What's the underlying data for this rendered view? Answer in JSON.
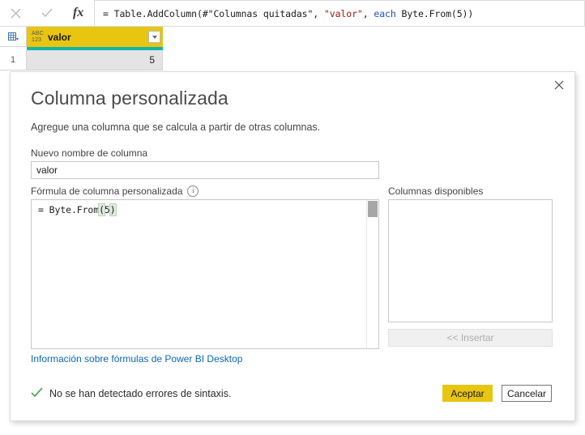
{
  "formula_bar": {
    "cancel_icon": "close-x-icon",
    "accept_icon": "check-icon",
    "fx_label": "fx",
    "formula_segments": {
      "prefix": "= Table.AddColumn(#\"Columnas quitadas\", ",
      "string_literal": "\"valor\"",
      "comma": ", ",
      "keyword": "each",
      "suffix": " Byte.From(5))"
    },
    "formula_full": "= Table.AddColumn(#\"Columnas quitadas\", \"valor\", each Byte.From(5))"
  },
  "grid": {
    "column": {
      "type_badge_top": "ABC",
      "type_badge_bottom": "123",
      "name": "valor",
      "dropdown_icon": "chevron-down-icon",
      "header_color": "#e8c511",
      "underline_color": "#10b5ab"
    },
    "rows": [
      {
        "index": "1",
        "value": "5"
      }
    ]
  },
  "dialog": {
    "close_icon": "close-x-icon",
    "title": "Columna personalizada",
    "subtitle": "Agregue una columna que se calcula a partir de otras columnas.",
    "new_name": {
      "label": "Nuevo nombre de columna",
      "value": "valor",
      "placeholder": ""
    },
    "formula": {
      "label": "Fórmula de columna personalizada",
      "info_icon": "info-circle-icon",
      "value": "= Byte.From(5)",
      "segments": {
        "head": "= Byte.From",
        "open_paren": "(",
        "number": "5",
        "close_paren": ")"
      },
      "scrollbar": "vertical-scrollbar"
    },
    "help_link": "Información sobre fórmulas de Power BI Desktop",
    "available_columns": {
      "label": "Columnas disponibles",
      "items": [],
      "insert_button": "<< Insertar",
      "insert_enabled": false
    },
    "status": {
      "icon": "check-icon",
      "text": "No se han detectado errores de sintaxis.",
      "color": "#53a653"
    },
    "buttons": {
      "accept": "Aceptar",
      "cancel": "Cancelar",
      "accept_color": "#e8c511"
    }
  }
}
